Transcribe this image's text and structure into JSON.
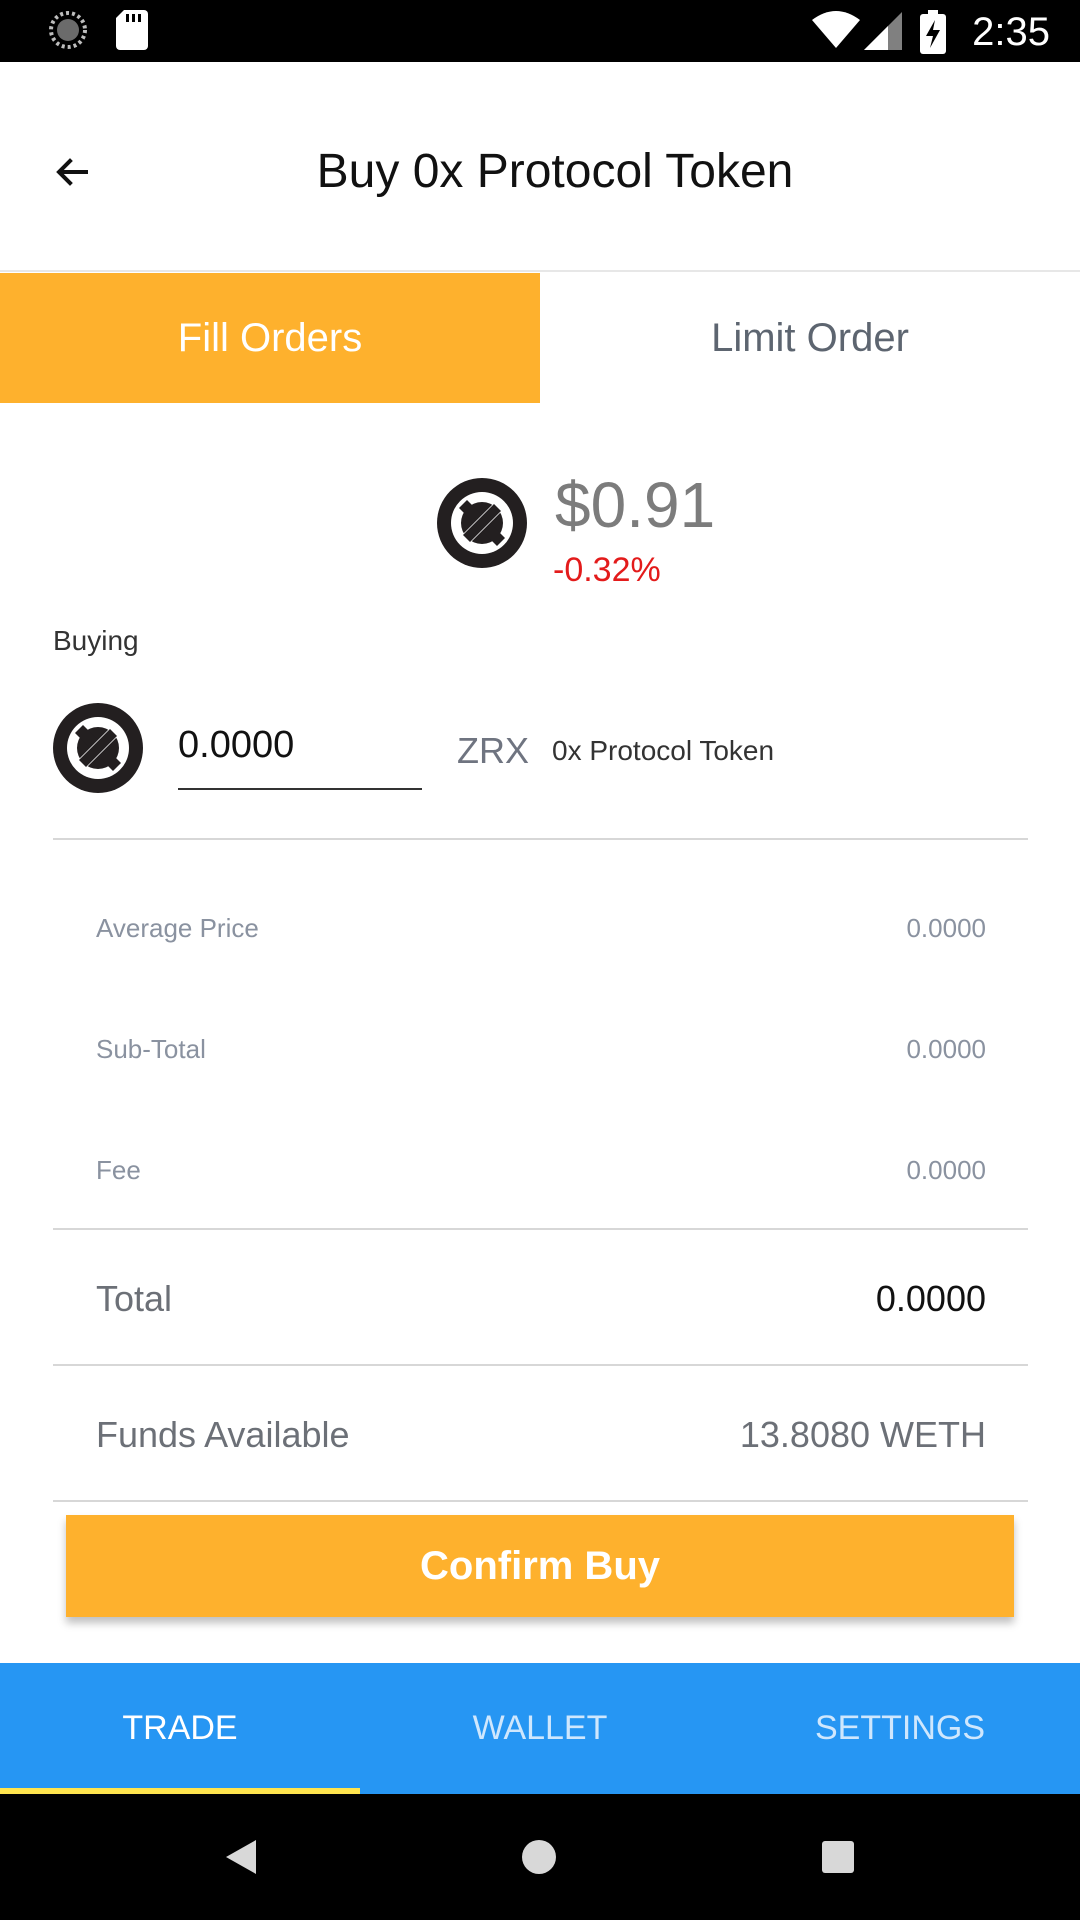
{
  "status_bar": {
    "time": "2:35"
  },
  "header": {
    "title": "Buy 0x Protocol Token"
  },
  "tabs": [
    {
      "label": "Fill Orders",
      "active": true
    },
    {
      "label": "Limit Order",
      "active": false
    }
  ],
  "price_summary": {
    "price": "$0.91",
    "change": "-0.32%"
  },
  "buying": {
    "label": "Buying",
    "amount": "0.0000",
    "symbol": "ZRX",
    "token_name": "0x Protocol Token"
  },
  "summary": {
    "average_price": {
      "label": "Average Price",
      "value": "0.0000"
    },
    "sub_total": {
      "label": "Sub-Total",
      "value": "0.0000"
    },
    "fee": {
      "label": "Fee",
      "value": "0.0000"
    },
    "total": {
      "label": "Total",
      "value": "0.0000"
    },
    "funds_available": {
      "label": "Funds Available",
      "value": "13.8080 WETH"
    }
  },
  "confirm_button": {
    "label": "Confirm Buy"
  },
  "bottom_nav": [
    {
      "label": "TRADE",
      "active": true
    },
    {
      "label": "WALLET",
      "active": false
    },
    {
      "label": "SETTINGS",
      "active": false
    }
  ],
  "colors": {
    "accent": "#feb12d",
    "nav_blue": "#2696f3",
    "negative": "#e31b1b",
    "indicator": "#ffe44d"
  },
  "icons": [
    "loading-circle-icon",
    "sd-card-icon",
    "wifi-icon",
    "cell-signal-icon",
    "battery-charging-icon",
    "back-arrow-icon",
    "zrx-token-icon",
    "triangle-back-icon",
    "circle-home-icon",
    "square-recents-icon"
  ]
}
